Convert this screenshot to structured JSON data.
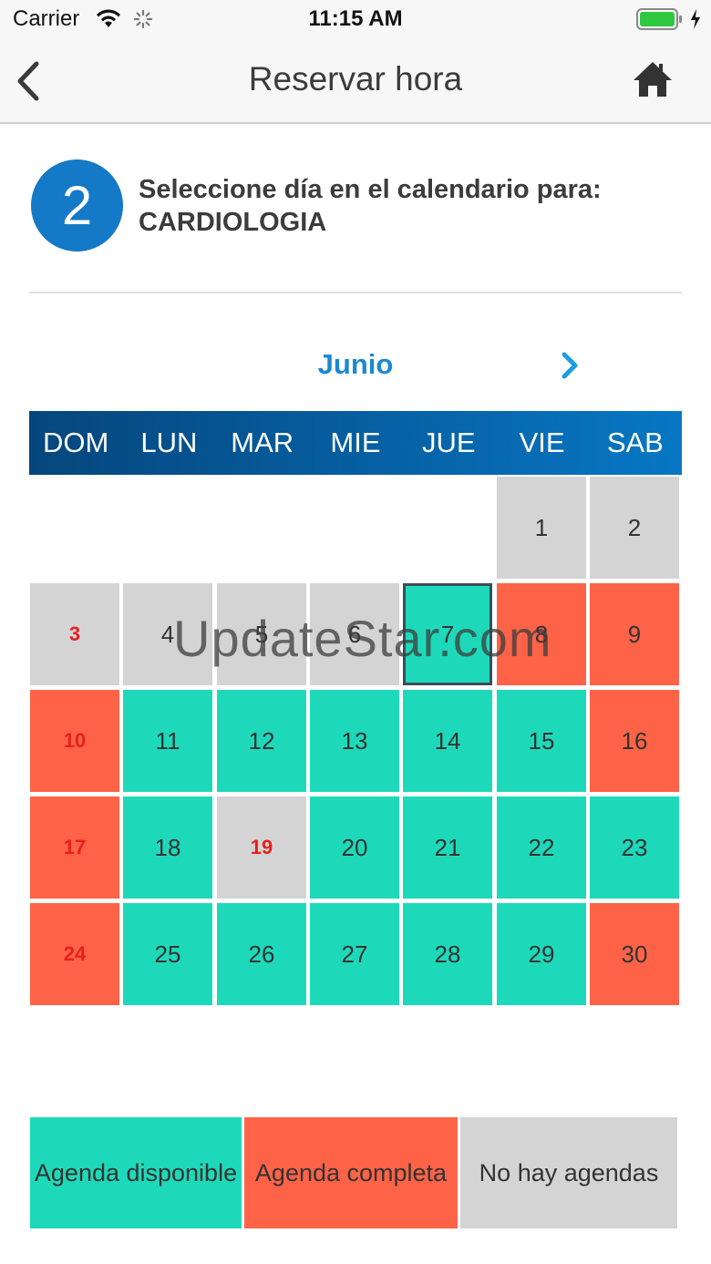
{
  "status_bar": {
    "carrier": "Carrier",
    "time": "11:15 AM",
    "battery_color": "#2ec93f"
  },
  "nav": {
    "title": "Reservar hora",
    "back_icon": "chevron-left-icon",
    "home_icon": "home-icon"
  },
  "step": {
    "number": "2",
    "instruction": "Seleccione día en el calendario para:",
    "specialty": "CARDIOLOGIA"
  },
  "calendar": {
    "month": "Junio",
    "weekdays": [
      "DOM",
      "LUN",
      "MAR",
      "MIE",
      "JUE",
      "VIE",
      "SAB"
    ],
    "selected_day": "7",
    "weeks": [
      [
        null,
        null,
        null,
        null,
        null,
        {
          "d": "1",
          "s": "none"
        },
        {
          "d": "2",
          "s": "none"
        }
      ],
      [
        {
          "d": "3",
          "s": "none",
          "red": true
        },
        {
          "d": "4",
          "s": "none"
        },
        {
          "d": "5",
          "s": "none"
        },
        {
          "d": "6",
          "s": "none"
        },
        {
          "d": "7",
          "s": "available"
        },
        {
          "d": "8",
          "s": "full"
        },
        {
          "d": "9",
          "s": "full"
        }
      ],
      [
        {
          "d": "10",
          "s": "full",
          "red": true
        },
        {
          "d": "11",
          "s": "available"
        },
        {
          "d": "12",
          "s": "available"
        },
        {
          "d": "13",
          "s": "available"
        },
        {
          "d": "14",
          "s": "available"
        },
        {
          "d": "15",
          "s": "available"
        },
        {
          "d": "16",
          "s": "full"
        }
      ],
      [
        {
          "d": "17",
          "s": "full",
          "red": true
        },
        {
          "d": "18",
          "s": "available"
        },
        {
          "d": "19",
          "s": "none",
          "red": true
        },
        {
          "d": "20",
          "s": "available"
        },
        {
          "d": "21",
          "s": "available"
        },
        {
          "d": "22",
          "s": "available"
        },
        {
          "d": "23",
          "s": "available"
        }
      ],
      [
        {
          "d": "24",
          "s": "full",
          "red": true
        },
        {
          "d": "25",
          "s": "available"
        },
        {
          "d": "26",
          "s": "available"
        },
        {
          "d": "27",
          "s": "available"
        },
        {
          "d": "28",
          "s": "available"
        },
        {
          "d": "29",
          "s": "available"
        },
        {
          "d": "30",
          "s": "full"
        }
      ]
    ]
  },
  "legend": {
    "available": "Agenda disponible",
    "full": "Agenda completa",
    "none": "No hay agendas"
  },
  "colors": {
    "available": "#1ed9b9",
    "full": "#ff6347",
    "none": "#d4d4d4",
    "accent": "#1479c6"
  },
  "watermark": "UpdateStar.com"
}
